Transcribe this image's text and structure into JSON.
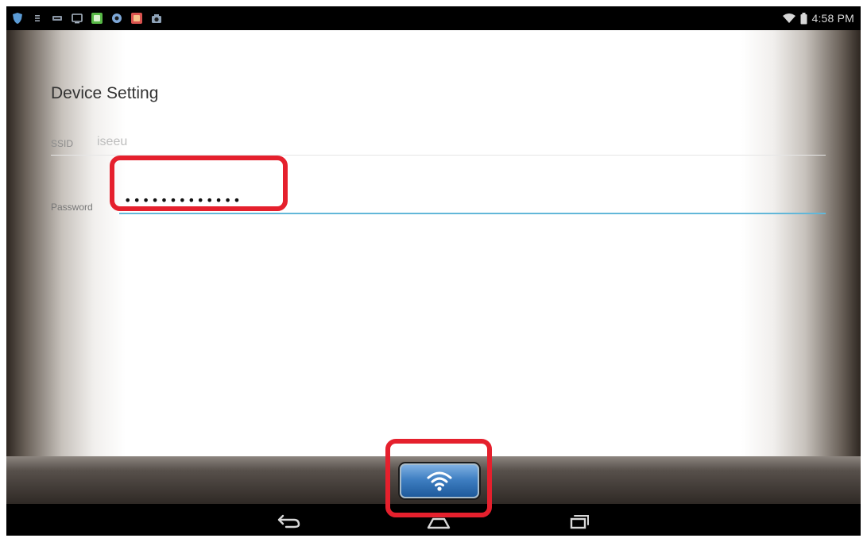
{
  "status_bar": {
    "time": "4:58 PM",
    "notification_icons": [
      "shield-icon",
      "menu-lines-icon",
      "news-icon",
      "monitor-icon",
      "green-app-icon",
      "settings-icon",
      "red-app-icon",
      "camera-icon"
    ],
    "status_icons": [
      "wifi-signal-icon",
      "battery-icon"
    ]
  },
  "screen": {
    "title": "Device Setting",
    "ssid": {
      "label": "SSID",
      "value": "iseeu"
    },
    "password": {
      "label": "Password",
      "value": "•••••••••••••"
    }
  },
  "action_bar": {
    "wifi_button_icon": "wifi-icon",
    "accent_color": "#3f7fc2"
  },
  "nav_bar": {
    "buttons": [
      "back-icon",
      "home-icon",
      "recent-apps-icon"
    ]
  },
  "annotations": {
    "highlight_color": "#e5202d",
    "highlighted": [
      "password-input",
      "wifi-button"
    ]
  },
  "colors": {
    "input_underline": "#62b7d9",
    "status_bar": "#000000"
  }
}
